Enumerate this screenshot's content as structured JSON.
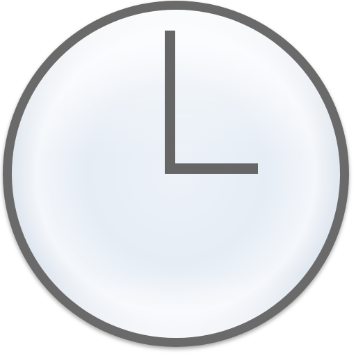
{
  "icon": {
    "name": "clock-icon",
    "time_shown": "3:00"
  },
  "colors": {
    "background": "#ffffff",
    "rim": "#6b6b6b",
    "hands": "#666666",
    "face_center": "#e6edf5",
    "face_highlight": "#ffffff",
    "face_edge": "#dde5ee"
  }
}
